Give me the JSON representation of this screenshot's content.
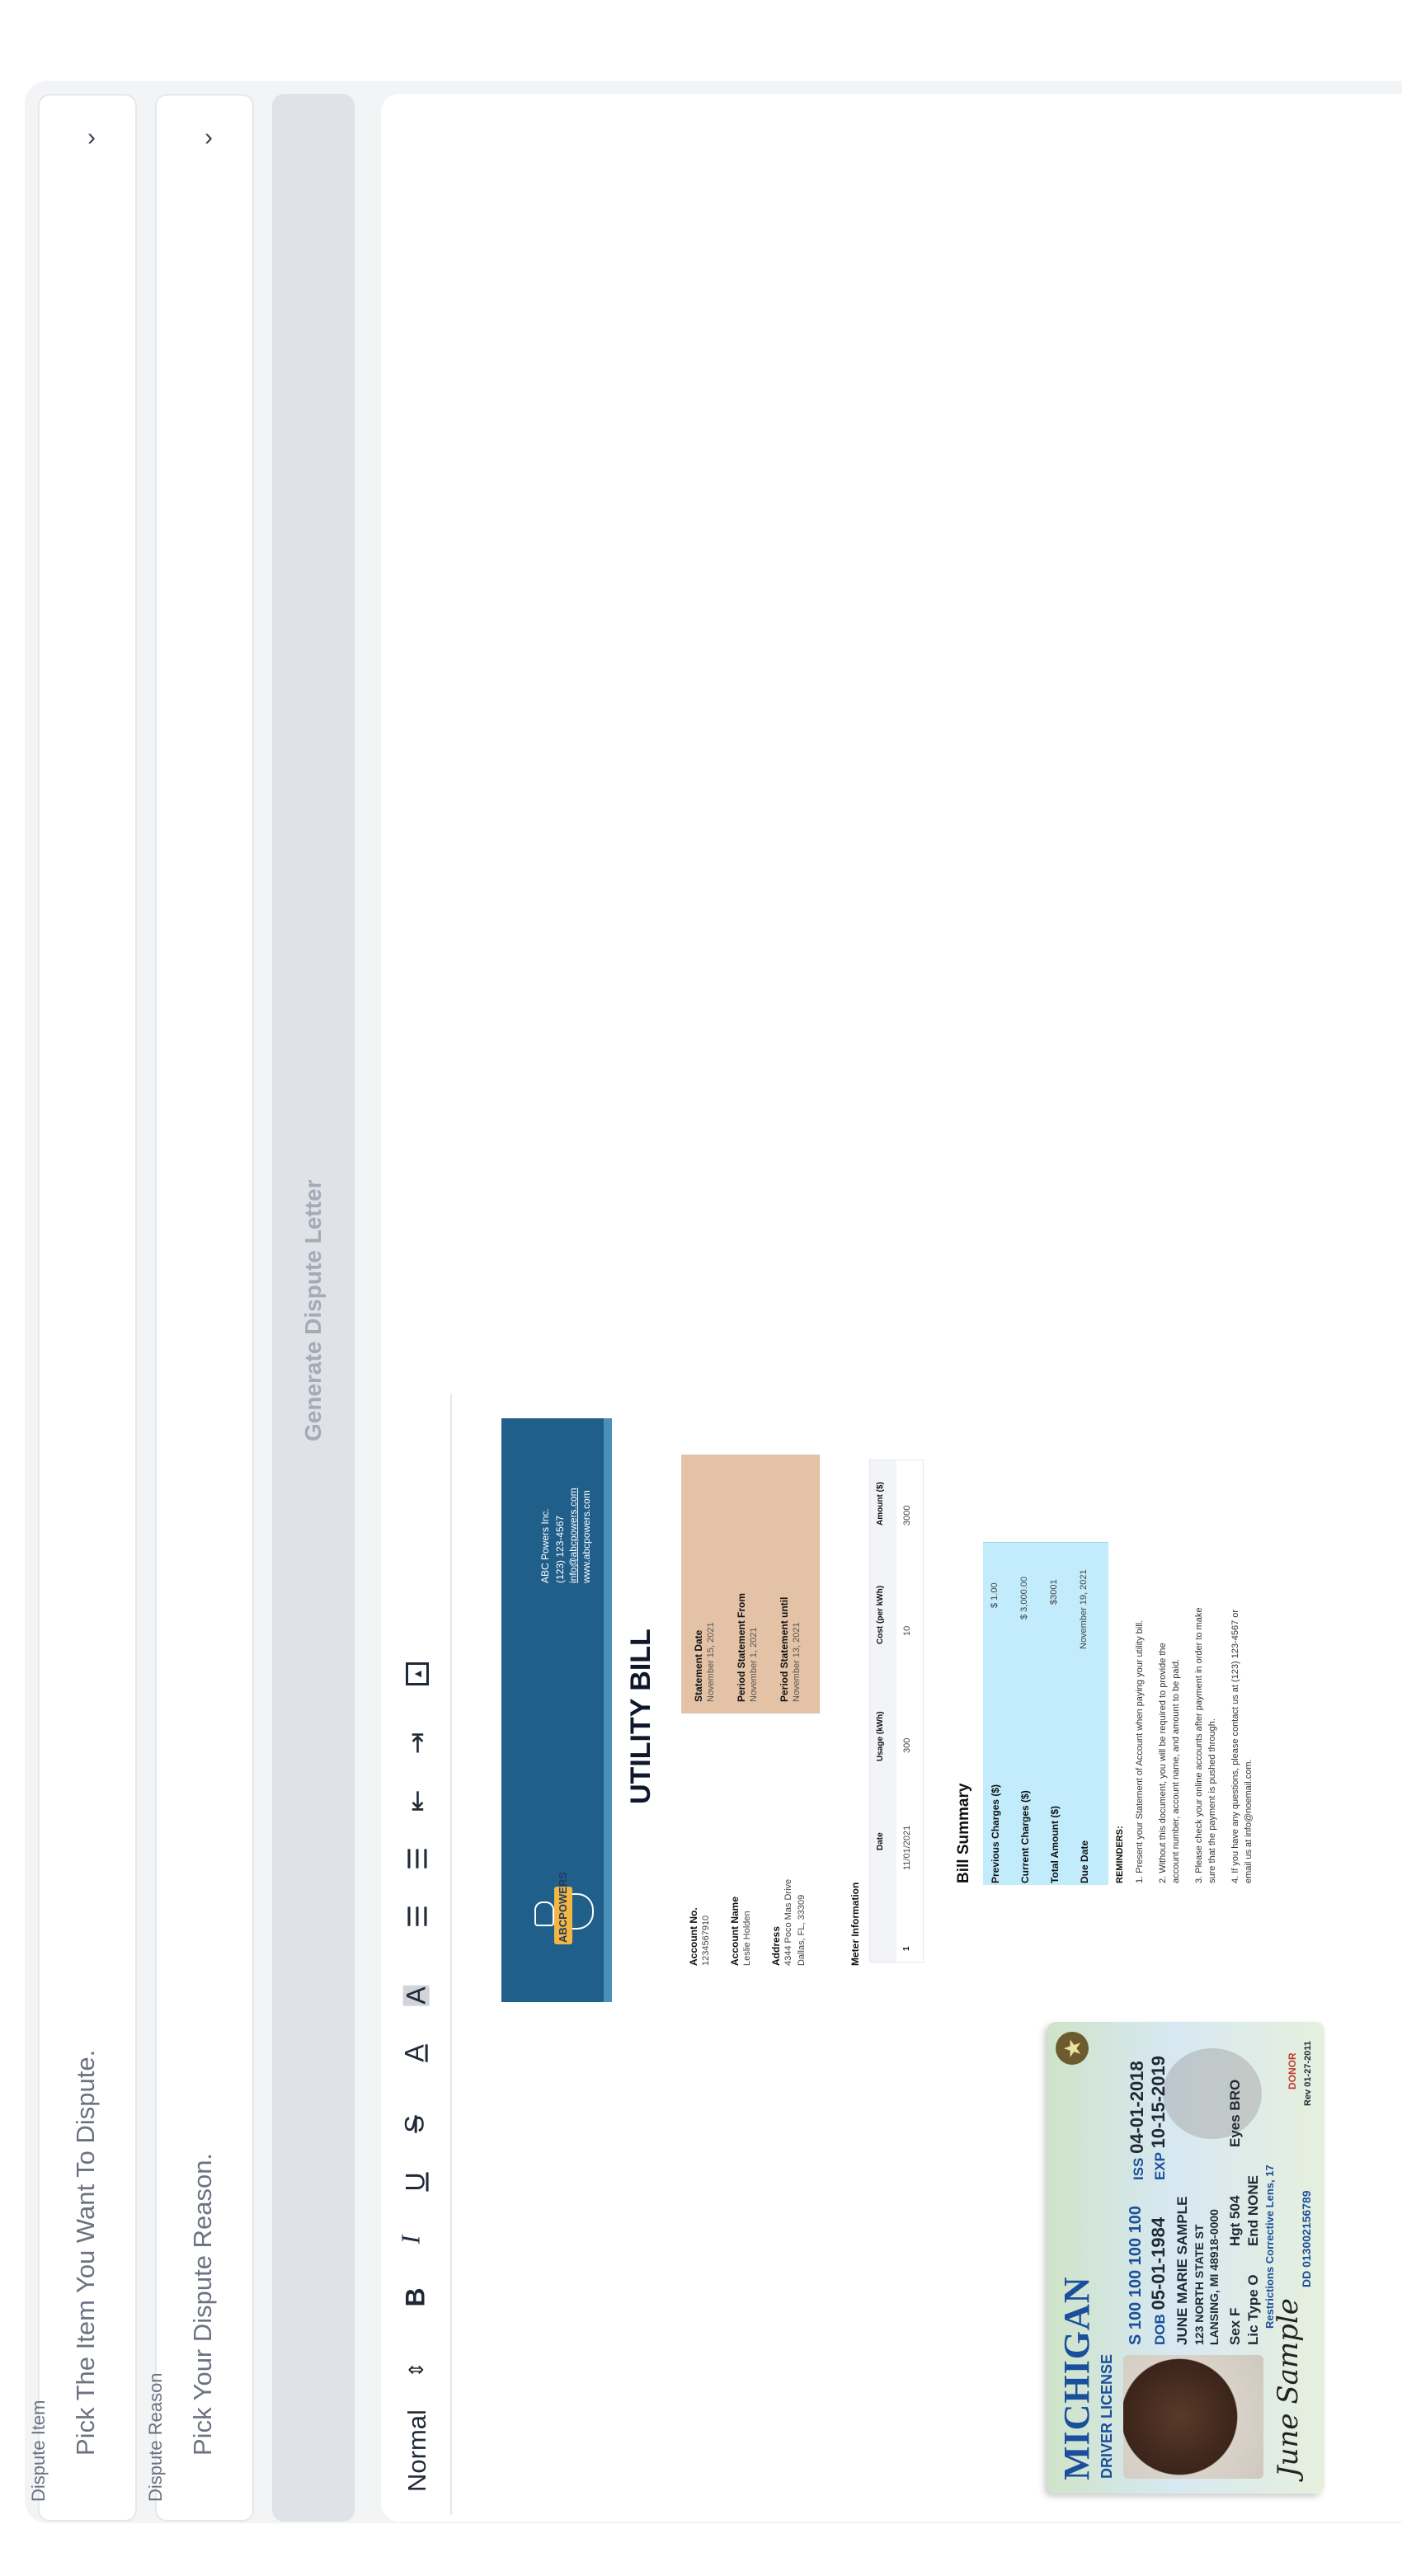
{
  "dispute_item": {
    "label": "Dispute Item",
    "placeholder": "Pick The Item You Want To Dispute."
  },
  "dispute_reason": {
    "label": "Dispute Reason",
    "placeholder": "Pick Your Dispute Reason."
  },
  "generate_button": {
    "label": "Generate Dispute Letter"
  },
  "toolbar": {
    "heading_select": "Normal",
    "icons": [
      "select-arrows-icon",
      "bold-icon",
      "italic-icon",
      "underline-icon",
      "strikethrough-icon",
      "text-color-icon",
      "highlight-color-icon",
      "numbered-list-icon",
      "bullet-list-icon",
      "outdent-icon",
      "indent-icon",
      "image-icon"
    ]
  },
  "license": {
    "state": "MICHIGAN",
    "type": "DRIVER LICENSE",
    "number": "S 100 100 100 100",
    "dob_label": "DOB",
    "dob": "05-01-1984",
    "iss_label": "ISS",
    "iss": "04-01-2018",
    "exp_label": "EXP",
    "exp": "10-15-2019",
    "name": "JUNE MARIE SAMPLE",
    "addr1": "123 NORTH STATE ST",
    "addr2": "LANSING, MI 48918-0000",
    "sex": "Sex F",
    "height": "Hgt 504",
    "eyes": "Eyes BRO",
    "lic_type": "Lic Type O",
    "end": "End NONE",
    "restrictions": "Restrictions Corrective Lens, 17",
    "dd": "DD 013002156789",
    "donor": "DONOR",
    "donor_date": "Rev 01-27-2011",
    "signature": "June Sample"
  },
  "bill": {
    "company": "ABC Powers Inc.",
    "phone": "(123) 123-4567",
    "email": "info@abcpowers.com",
    "website": "www.abcpowers.com",
    "logo_text": "ABCPOWERS",
    "title": "UTILITY BILL",
    "account_no_label": "Account No.",
    "account_no": "1234567910",
    "account_name_label": "Account Name",
    "account_name": "Leslie Holden",
    "address_label": "Address",
    "address1": "4344 Poco Mas Drive",
    "address2": "Dallas, FL, 33309",
    "statement_date_label": "Statement Date",
    "statement_date": "November 15, 2021",
    "period_from_label": "Period Statement From",
    "period_from": "November 1, 2021",
    "period_until_label": "Period Statement until",
    "period_until": "November 13, 2021",
    "meter_title": "Meter Information",
    "meter_headers": [
      "Date",
      "Usage (kWh)",
      "Cost (per kWh)",
      "Amount ($)"
    ],
    "meter_row": {
      "index": "1",
      "date": "11/01/2021",
      "usage": "300",
      "cost": "10",
      "amount": "3000"
    },
    "summary_title": "Bill Summary",
    "summary": [
      {
        "label": "Previous Charges ($)",
        "value": "$ 1.00"
      },
      {
        "label": "Current Charges ($)",
        "value": "$ 3,000.00"
      },
      {
        "label": "Total Amount ($)",
        "value": "$3001"
      },
      {
        "label": "Due Date",
        "value": "November 19, 2021"
      }
    ],
    "reminders_title": "REMINDERS:",
    "reminders": [
      "1. Present your Statement of Account when paying your utility bill.",
      "2. Without this document, you will be required to provide the",
      "account number, account name, and amount to be paid.",
      "3. Please check your online accounts after payment in order to make",
      "sure that the payment is pushed through.",
      "4. If you have any questions, please contact us at (123) 123-4567 or",
      "email us at info@noemail.com."
    ]
  }
}
